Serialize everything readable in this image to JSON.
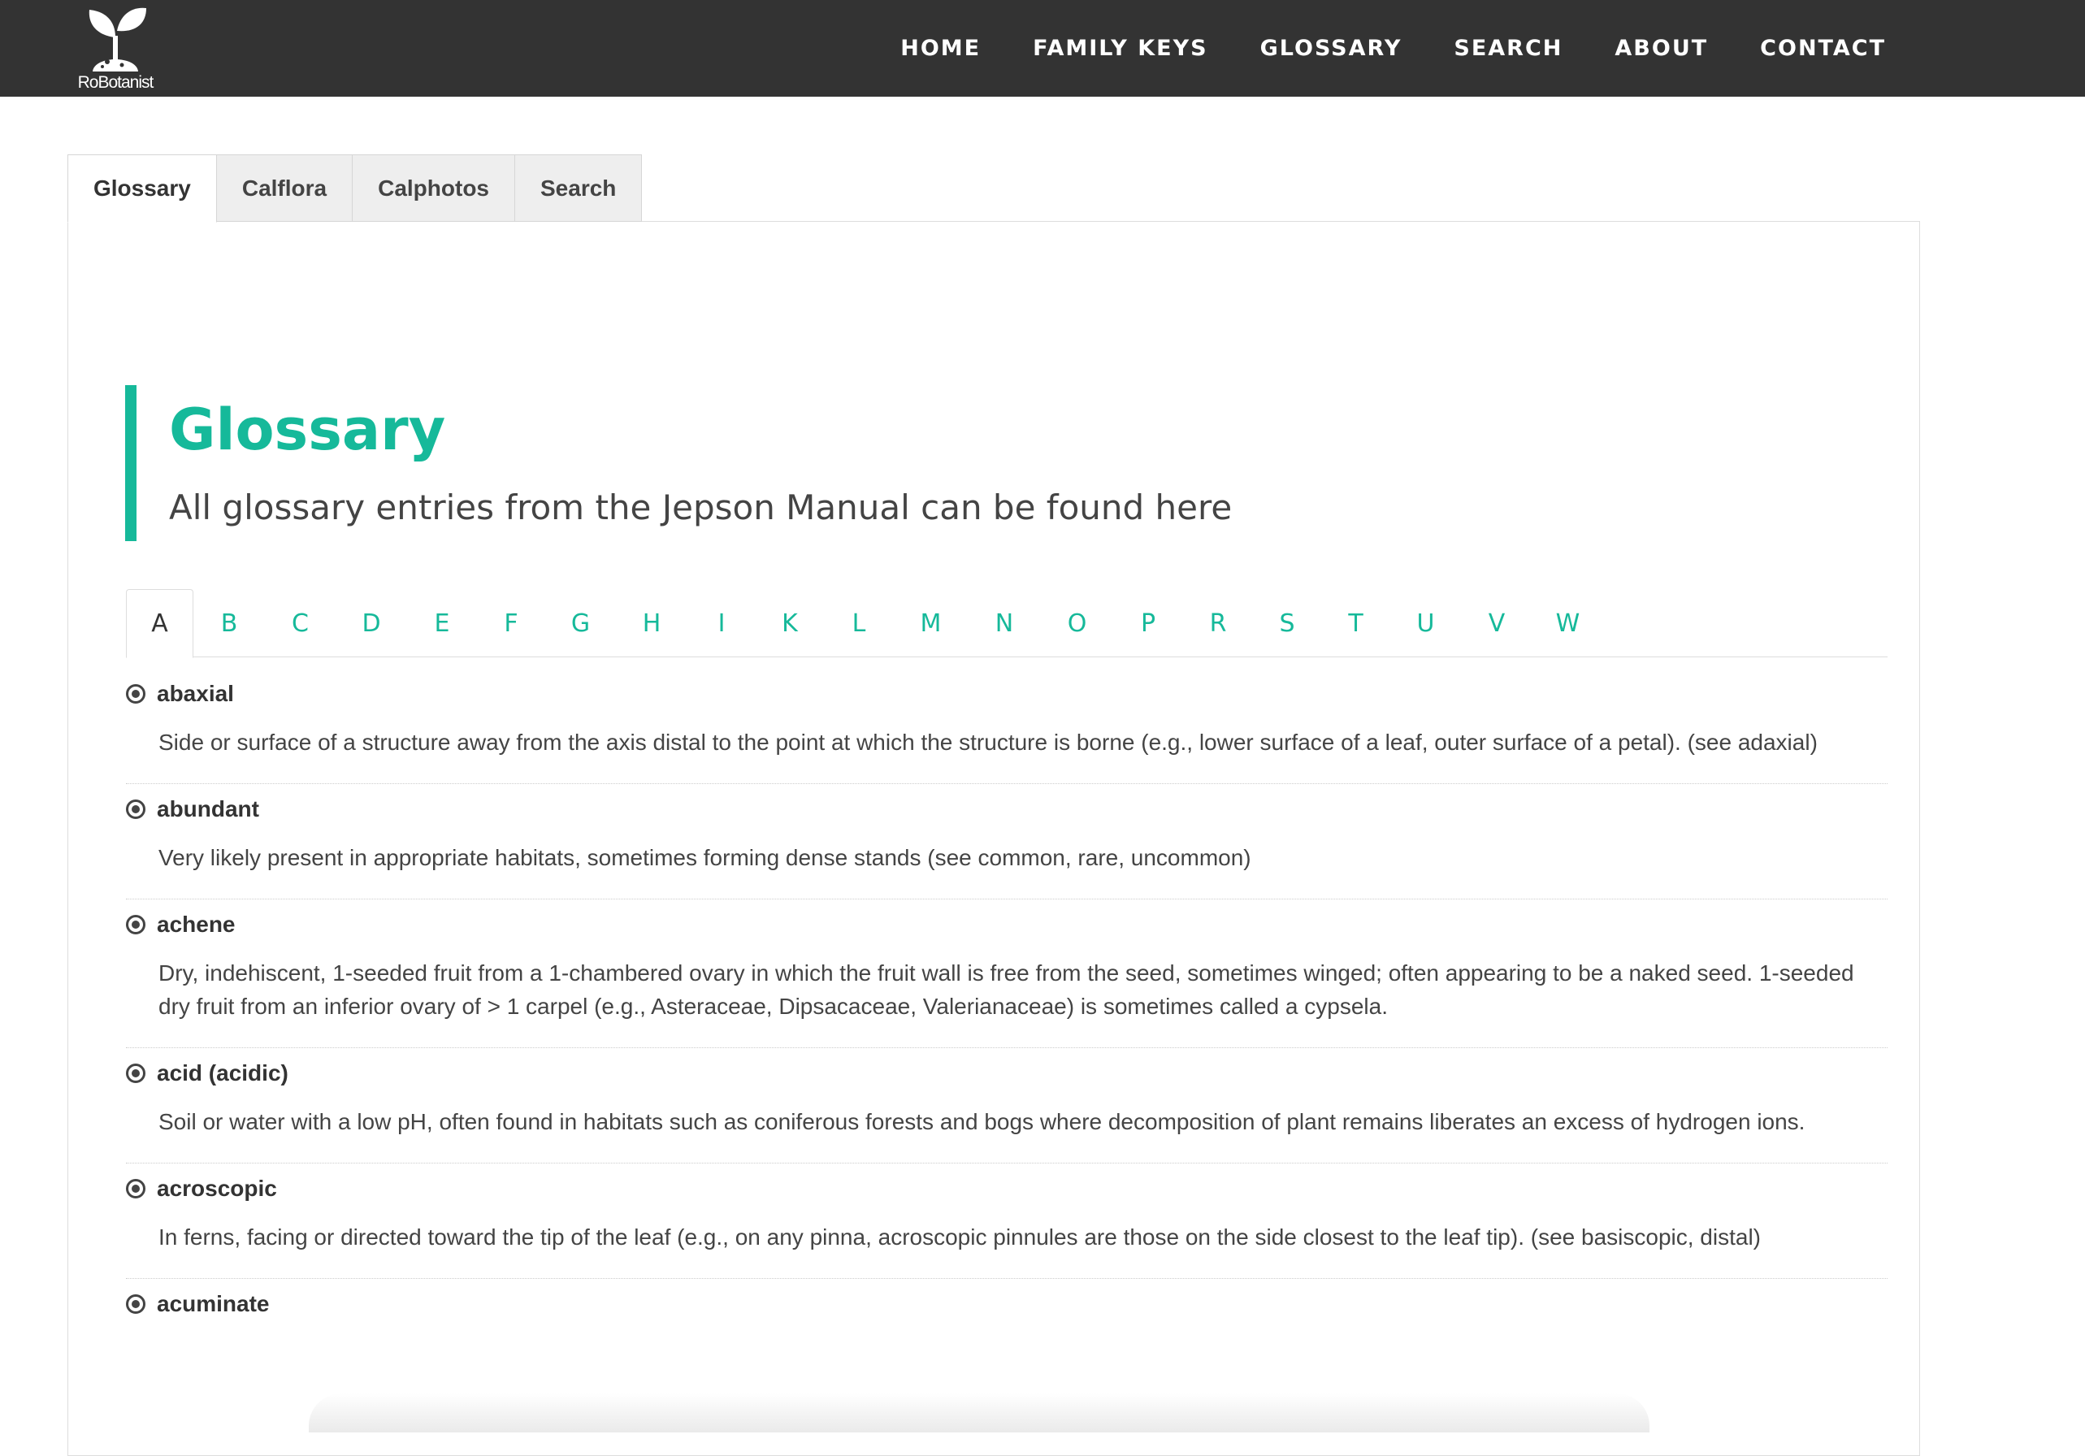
{
  "brand": {
    "name": "RoBotanist"
  },
  "nav": {
    "items": [
      "HOME",
      "FAMILY KEYS",
      "GLOSSARY",
      "SEARCH",
      "ABOUT",
      "CONTACT"
    ]
  },
  "outer_tabs": {
    "items": [
      "Glossary",
      "Calflora",
      "Calphotos",
      "Search"
    ],
    "active": "Glossary"
  },
  "heading": {
    "title": "Glossary",
    "subtitle": "All glossary entries from the Jepson Manual can be found here"
  },
  "letters": {
    "items": [
      "A",
      "B",
      "C",
      "D",
      "E",
      "F",
      "G",
      "H",
      "I",
      "K",
      "L",
      "M",
      "N",
      "O",
      "P",
      "R",
      "S",
      "T",
      "U",
      "V",
      "W"
    ],
    "active": "A"
  },
  "entries": [
    {
      "term": "abaxial",
      "definition": "Side or surface of a structure away from the axis distal to the point at which the structure is borne (e.g., lower surface of a leaf, outer surface of a petal). (see adaxial)"
    },
    {
      "term": "abundant",
      "definition": "Very likely present in appropriate habitats, sometimes forming dense stands (see common, rare, uncommon)"
    },
    {
      "term": "achene",
      "definition": "Dry, indehiscent, 1-seeded fruit from a 1-chambered ovary in which the fruit wall is free from the seed, sometimes winged; often appearing to be a naked seed. 1-seeded dry fruit from an inferior ovary of > 1 carpel (e.g., Asteraceae, Dipsacaceae, Valerianaceae) is sometimes called a cypsela."
    },
    {
      "term": "acid (acidic)",
      "definition": "Soil or water with a low pH, often found in habitats such as coniferous forests and bogs where decomposition of plant remains liberates an excess of hydrogen ions."
    },
    {
      "term": "acroscopic",
      "definition": "In ferns, facing or directed toward the tip of the leaf (e.g., on any pinna, acroscopic pinnules are those on the side closest to the leaf tip). (see basiscopic, distal)"
    },
    {
      "term": "acuminate",
      "definition": ""
    }
  ],
  "colors": {
    "accent": "#16b99a",
    "navbar": "#333333"
  }
}
